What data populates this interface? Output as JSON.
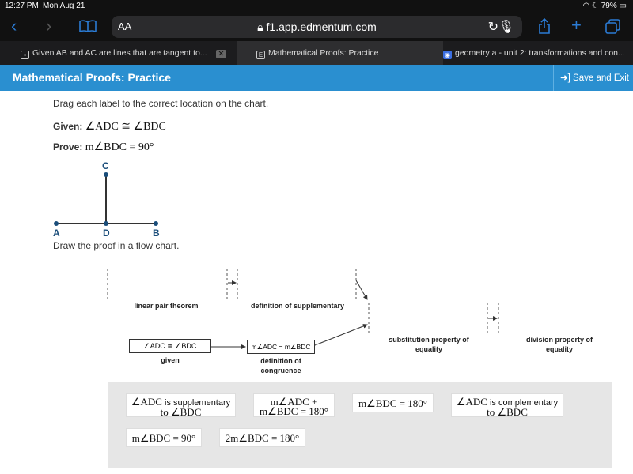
{
  "status_bar": {
    "time": "12:27 PM",
    "date": "Mon Aug 21",
    "battery": "79%"
  },
  "browser": {
    "text_size": "AA",
    "url": "f1.app.edmentum.com",
    "tabs": [
      {
        "label": "Given AB and AC are lines that are tangent to...",
        "icon": "bookmark-icon"
      },
      {
        "label": "Mathematical Proofs: Practice",
        "icon": "e-icon"
      },
      {
        "label": "geometry a - unit 2: transformations and con...",
        "icon": "search-icon"
      }
    ]
  },
  "app": {
    "title": "Mathematical Proofs: Practice",
    "save_exit": "Save and Exit"
  },
  "problem": {
    "instruction": "Drag each label to the correct location on the chart.",
    "given_label": "Given:",
    "given_expr": "∠ADC ≅ ∠BDC",
    "prove_label": "Prove:",
    "prove_expr": "m∠BDC = 90°",
    "points": {
      "c": "C",
      "a": "A",
      "d": "D",
      "b": "B"
    },
    "flow_instruction": "Draw the proof in a flow chart."
  },
  "flow_chart": {
    "reason_1": "linear pair theorem",
    "reason_2": "definition of supplementary",
    "reason_3": "substitution property of equality",
    "reason_4": "division property of equality",
    "statement_given": "∠ADC ≅ ∠BDC",
    "reason_given": "given",
    "statement_congruence": "m∠ADC = m∠BDC",
    "reason_congruence": "definition of congruence"
  },
  "label_bank": {
    "tile_1a": "∠ADC",
    "tile_1b": " is supplementary",
    "tile_1c": "to ∠BDC",
    "tile_2a": "m∠ADC +",
    "tile_2b": "m∠BDC = 180°",
    "tile_3": "m∠BDC = 180°",
    "tile_4a": "∠ADC",
    "tile_4b": " is complementary",
    "tile_4c": "to ∠BDC",
    "tile_5": "m∠BDC = 90°",
    "tile_6": "2m∠BDC = 180°"
  }
}
